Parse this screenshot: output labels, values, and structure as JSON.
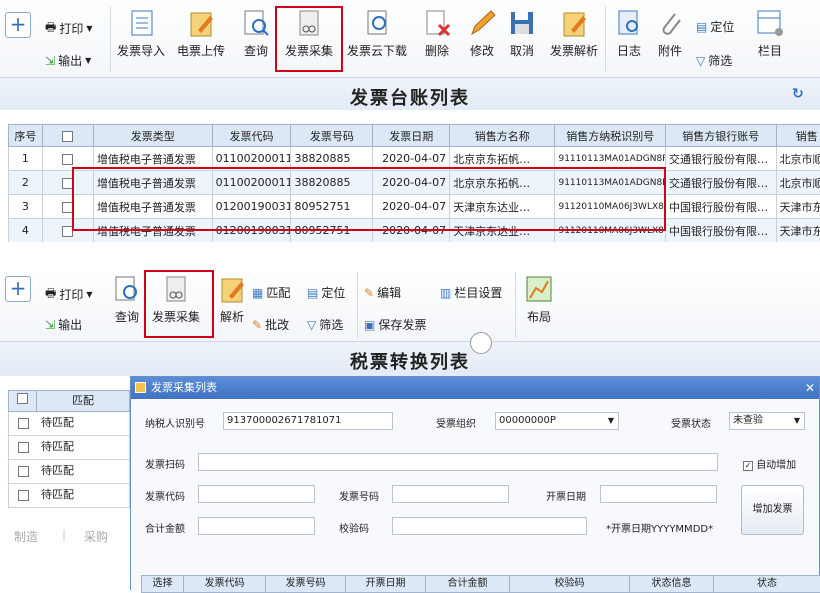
{
  "top_toolbar": {
    "print": "打印",
    "export": "输出",
    "import": "发票导入",
    "upload": "电票上传",
    "query": "查询",
    "collect": "发票采集",
    "cloud_download": "发票云下载",
    "delete": "删除",
    "edit": "修改",
    "cancel": "取消",
    "parse": "发票解析",
    "log": "日志",
    "attach": "附件",
    "locate": "定位",
    "filter": "筛选",
    "columns": "栏目"
  },
  "ledger": {
    "title": "发票台账列表",
    "headers": [
      "序号",
      "",
      "发票类型",
      "发票代码",
      "发票号码",
      "发票日期",
      "销售方名称",
      "销售方纳税识别号",
      "销售方银行账号",
      "销售"
    ],
    "rows": [
      [
        "1",
        "",
        "增值税电子普通发票",
        "011002000111",
        "38820885",
        "2020-04-07",
        "北京京东拓帆…",
        "91110113MA01ADGN8R",
        "交通银行股份有限…",
        "北京市顺"
      ],
      [
        "2",
        "",
        "增值税电子普通发票",
        "011002000111",
        "38820885",
        "2020-04-07",
        "北京京东拓帆…",
        "91110113MA01ADGN8R",
        "交通银行股份有限…",
        "北京市顺"
      ],
      [
        "3",
        "",
        "增值税电子普通发票",
        "012001900311",
        "80952751",
        "2020-04-07",
        "天津京东达业…",
        "91120110MA06J3WLX8",
        "中国银行股份有限…",
        "天津市东"
      ],
      [
        "4",
        "",
        "增值税电子普通发票",
        "012001900311",
        "80952751",
        "2020-04-07",
        "天津京东达业…",
        "91120110MA06J3WLX8",
        "中国银行股份有限…",
        "天津市东"
      ]
    ]
  },
  "second_toolbar": {
    "print": "打印",
    "export": "输出",
    "query": "查询",
    "collect": "发票采集",
    "parse": "解析",
    "match": "匹配",
    "locate": "定位",
    "batch_edit": "批改",
    "filter": "筛选",
    "edit": "编辑",
    "save": "保存发票",
    "col_settings": "栏目设置",
    "layout": "布局"
  },
  "tax_list": {
    "title": "税票转换列表",
    "header_match": "匹配",
    "rows": [
      "待匹配",
      "待匹配",
      "待匹配",
      "待匹配"
    ],
    "footer_left": "制造",
    "footer_right": "采购"
  },
  "dialog": {
    "title": "发票采集列表",
    "taxpayer_label": "纳税人识别号",
    "taxpayer_value": "913700002671781071",
    "org_label": "受票组织",
    "org_value": "00000000P",
    "status_label": "受票状态",
    "status_value": "未查验",
    "scan_label": "发票扫码",
    "auto_add": "自动增加",
    "code_label": "发票代码",
    "number_label": "发票号码",
    "date_label": "开票日期",
    "amount_label": "合计金额",
    "check_label": "校验码",
    "date_hint": "*开票日期YYYYMMDD*",
    "add_button": "增加发票",
    "grid_headers": [
      "选择",
      "发票代码",
      "发票号码",
      "开票日期",
      "合计金额",
      "校验码",
      "状态信息",
      "状态"
    ]
  }
}
